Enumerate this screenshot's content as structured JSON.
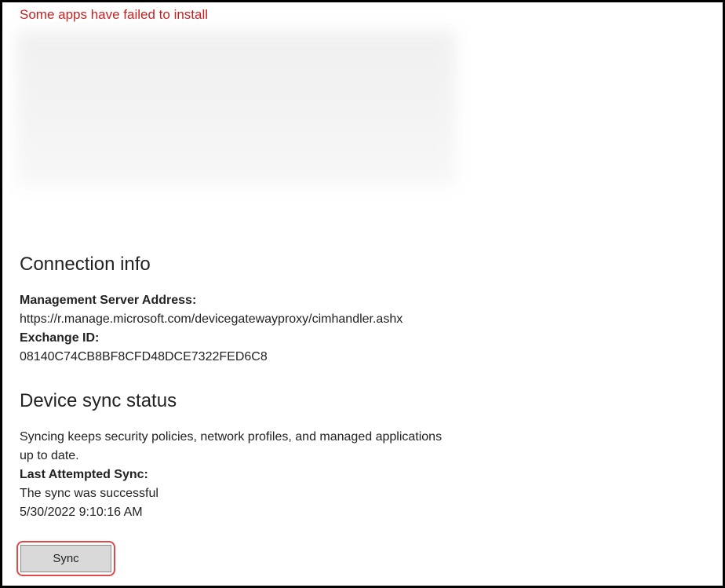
{
  "error_banner": "Some apps have failed to install",
  "connection_info": {
    "heading": "Connection info",
    "server_label": "Management Server Address:",
    "server_value": "https://r.manage.microsoft.com/devicegatewayproxy/cimhandler.ashx",
    "exchange_label": "Exchange ID:",
    "exchange_value": "08140C74CB8BF8CFD48DCE7322FED6C8"
  },
  "sync_status": {
    "heading": "Device sync status",
    "description": "Syncing keeps security policies, network profiles, and managed applications up to date.",
    "last_sync_label": "Last Attempted Sync:",
    "last_sync_result": "The sync was successful",
    "last_sync_time": "5/30/2022 9:10:16 AM",
    "button_label": "Sync"
  }
}
